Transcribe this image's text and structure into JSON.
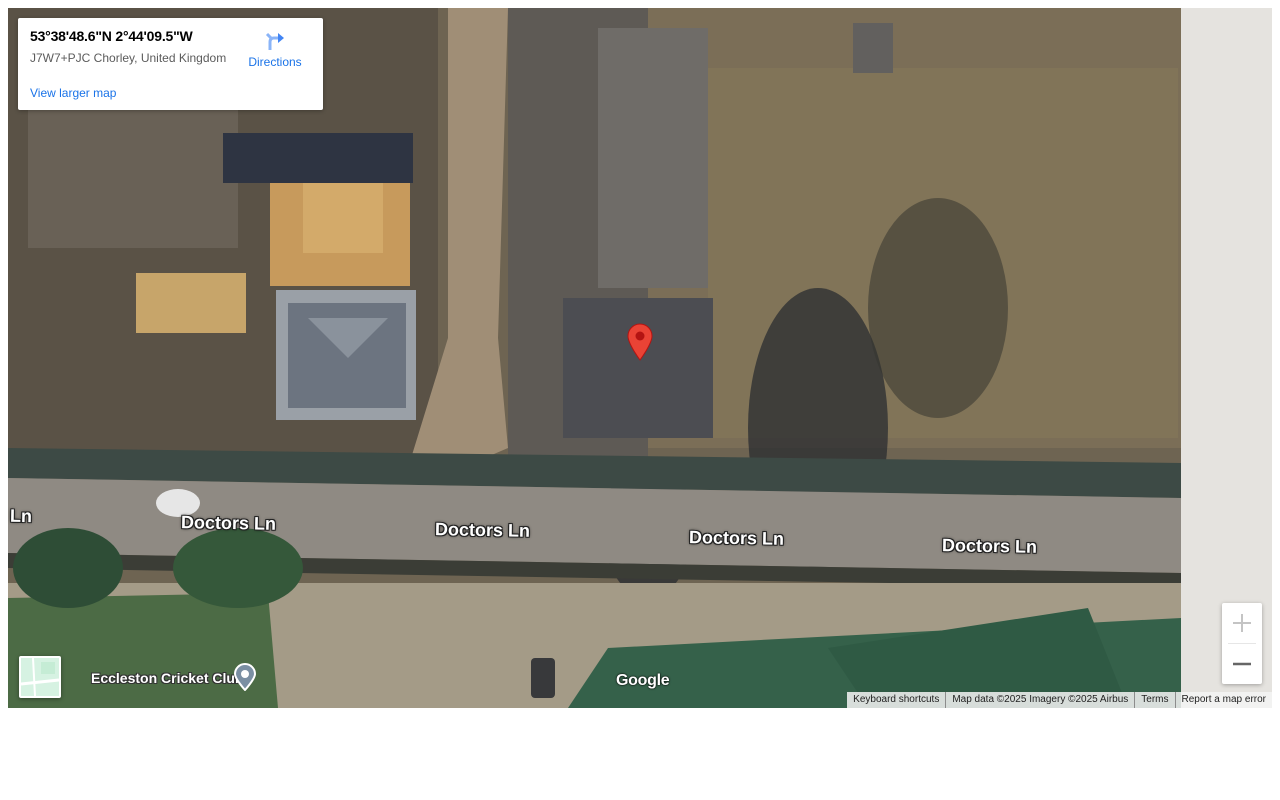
{
  "info_card": {
    "coordinates": "53°38'48.6\"N 2°44'09.5\"W",
    "plus_code": "J7W7+PJC Chorley, United Kingdom",
    "directions_label": "Directions",
    "larger_map_link": "View larger map"
  },
  "map": {
    "road_labels": [
      "Ln",
      "Doctors Ln",
      "Doctors Ln",
      "Doctors Ln",
      "Doctors Ln"
    ],
    "poi_label": "Eccleston Cricket Club",
    "logo_text": "Google",
    "imagery": "satellite"
  },
  "controls": {
    "zoom_in_icon": "plus-icon",
    "zoom_out_icon": "minus-icon",
    "layer_toggle_icon": "map-layer-thumbnail"
  },
  "attribution": {
    "keyboard_shortcuts": "Keyboard shortcuts",
    "map_data": "Map data ©2025 Imagery ©2025 Airbus",
    "terms": "Terms",
    "report": "Report a map error"
  },
  "colors": {
    "link_blue": "#1a73e8",
    "pin_red": "#ea4335"
  }
}
